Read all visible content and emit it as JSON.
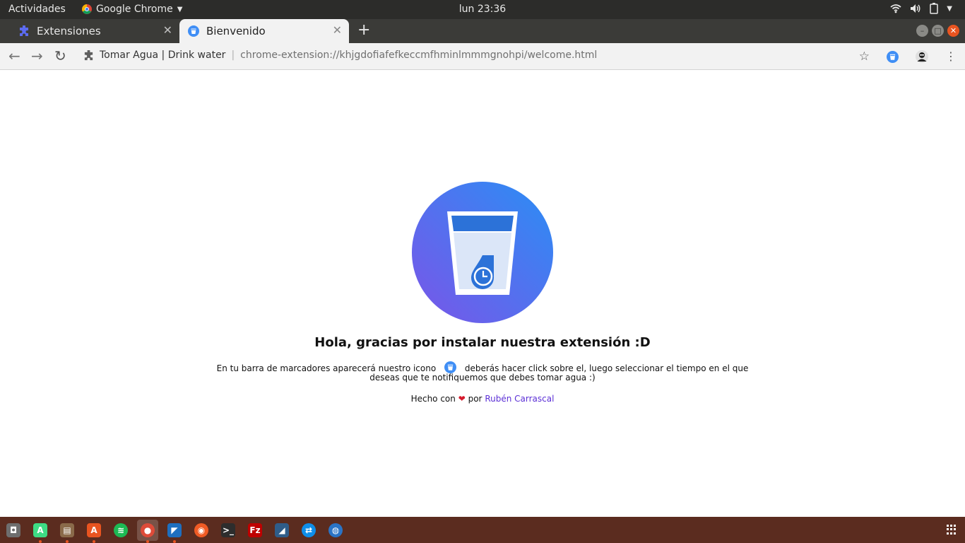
{
  "topbar": {
    "activities": "Actividades",
    "app_name": "Google Chrome",
    "clock": "lun 23:36"
  },
  "tabs": [
    {
      "title": "Extensiones",
      "active": false
    },
    {
      "title": "Bienvenido",
      "active": true
    }
  ],
  "toolbar": {
    "site_name": "Tomar Agua | Drink water",
    "url": "chrome-extension://khjgdofiafefkeccmfhminlmmmgnohpi/welcome.html"
  },
  "page": {
    "heading": "Hola, gracias por instalar nuestra extensión :D",
    "desc_before": "En tu barra de marcadores aparecerá nuestro icono",
    "desc_after": "deberás hacer click sobre el, luego seleccionar el tiempo en el que deseas que te notifiquemos que debes tomar agua :)",
    "credit_before": "Hecho con",
    "credit_heart": "❤",
    "credit_by": "por",
    "author": "Rubén Carrascal"
  },
  "colors": {
    "accent_gradient_start": "#7a55e8",
    "accent_gradient_end": "#2a8ef5",
    "link": "#5b2fd6",
    "heart": "#d51a2c",
    "dock_bg": "#5b2c1f",
    "ubuntu_orange": "#e95420"
  },
  "dock_apps": [
    {
      "name": "screenshot",
      "color": "#6e6e6e",
      "glyph": "◘"
    },
    {
      "name": "android-studio",
      "color": "#3ddc84",
      "glyph": "A"
    },
    {
      "name": "files",
      "color": "#8a6a4a",
      "glyph": "▤"
    },
    {
      "name": "software",
      "color": "#e95420",
      "glyph": "A"
    },
    {
      "name": "spotify",
      "color": "#1db954",
      "glyph": "≋"
    },
    {
      "name": "chrome",
      "color": "#dd4b39",
      "glyph": "●"
    },
    {
      "name": "vscode",
      "color": "#1e6fbf",
      "glyph": "◤"
    },
    {
      "name": "postman",
      "color": "#ef5b25",
      "glyph": "◉"
    },
    {
      "name": "terminal",
      "color": "#2d2d2d",
      "glyph": ">_"
    },
    {
      "name": "filezilla",
      "color": "#bf0000",
      "glyph": "Fz"
    },
    {
      "name": "mysql-workbench",
      "color": "#2f5d8a",
      "glyph": "◢"
    },
    {
      "name": "teamviewer",
      "color": "#0e8ee9",
      "glyph": "⇄"
    },
    {
      "name": "app",
      "color": "#2a74c6",
      "glyph": "◍"
    }
  ]
}
